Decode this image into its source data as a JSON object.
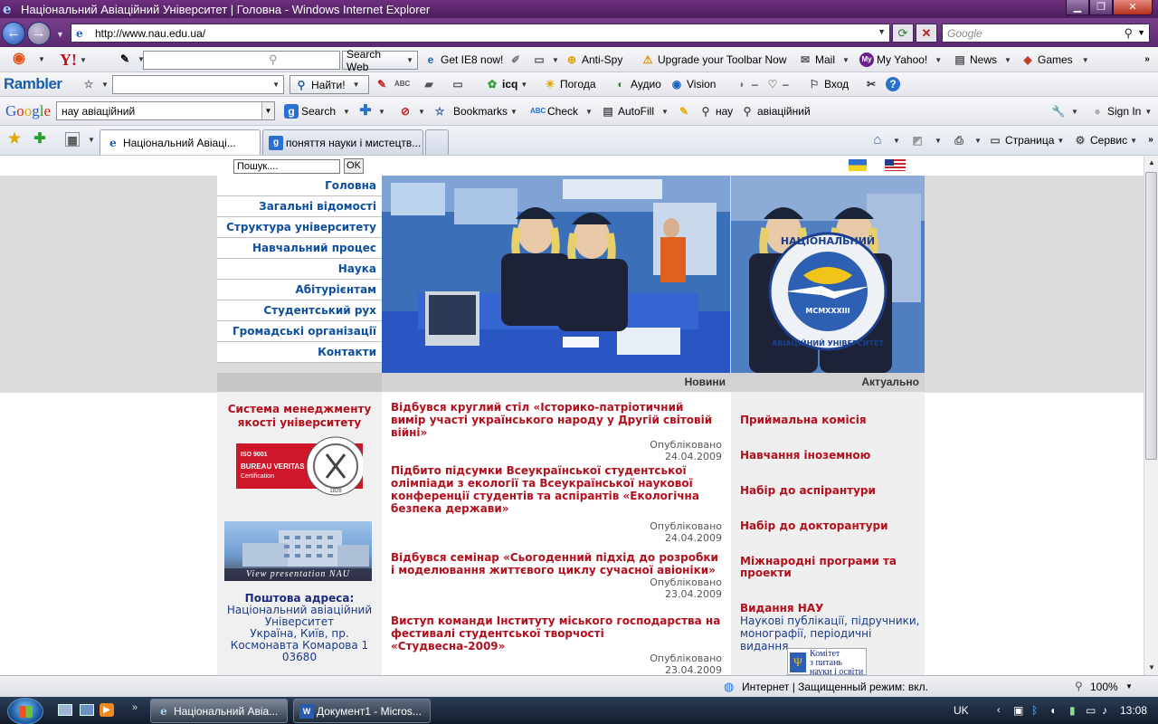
{
  "window": {
    "title": "Національний Авіаційний Університет | Головна - Windows Internet Explorer",
    "ie_glyph": "e"
  },
  "address": {
    "url": "http://www.nau.edu.ua/",
    "search_placeholder": "Google"
  },
  "toolbar1": {
    "search_web": "Search Web",
    "get_ie8": "Get IE8 now!",
    "anti_spy": "Anti-Spy",
    "upgrade": "Upgrade your Toolbar Now",
    "mail": "Mail",
    "my_yahoo": "My Yahoo!",
    "news": "News",
    "games": "Games"
  },
  "toolbar2": {
    "logo": "Rambler",
    "find": "Найти!",
    "icq": "icq",
    "weather": "Погода",
    "audio": "Аудио",
    "vision": "Vision",
    "dash1": "–",
    "dash2": "–",
    "login": "Вход"
  },
  "toolbar3": {
    "logo_letters": [
      "G",
      "o",
      "o",
      "g",
      "l",
      "e"
    ],
    "query": "нау авіаційний",
    "search": "Search",
    "bookmarks": "Bookmarks",
    "check": "Check",
    "autofill": "AutoFill",
    "word1": "нау",
    "word2": "авіаційний",
    "sign_in": "Sign In"
  },
  "tabs": [
    {
      "label": "Національний Авіаці...",
      "active": true
    },
    {
      "label": "поняття науки і мистецтв...",
      "active": false
    }
  ],
  "commandbar": {
    "page": "Страница",
    "tools": "Сервис"
  },
  "site": {
    "search_placeholder": "Пошук....",
    "ok": "OK",
    "nav": [
      "Головна",
      "Загальні відомості",
      "Структура університету",
      "Навчальний процес",
      "Наука",
      "Абітурієнтам",
      "Студентський рух",
      "Громадські організації",
      "Контакти"
    ],
    "news_header": "Новини",
    "actual_header": "Актуально",
    "logo_ring_top": "НАЦІОНАЛЬНИЙ",
    "logo_ring_bottom": "АВІАЦІЙНИЙ УНІВЕРСИТЕТ",
    "logo_year": "MCMXXXIII",
    "quality_title": "Система менеджменту якості університету",
    "bv_lines": [
      "ISO 9001",
      "BUREAU VERITAS",
      "Certification"
    ],
    "bv_seal": "1828",
    "presentation_label": "View presentation NAU",
    "postal_title": "Поштова адреса:",
    "postal_lines": [
      "Національний авіаційний",
      "Університет",
      "Україна, Київ, пр.",
      "Космонавта Комарова 1",
      "03680"
    ],
    "news": [
      {
        "title": "Відбувся круглий стіл «Історико-патріотичний вимір участі українського народу у Другій світовій війні»",
        "published": "Опубліковано",
        "date": "24.04.2009"
      },
      {
        "title": "Підбито підсумки Всеукраїнської студентської олімпіади з екології та Всеукраїнської наукової конференції студентів та аспірантів «Екологічна безпека держави»",
        "published": "Опубліковано",
        "date": "24.04.2009"
      },
      {
        "title": "Відбувся семінар «Сьогоденний підхід до розробки і моделювання життєвого циклу сучасної авіоніки»",
        "published": "Опубліковано",
        "date": "23.04.2009"
      },
      {
        "title": "Виступ команди Інституту міського господарства на фестивалі студентської творчості «Студвесна-2009»",
        "published": "Опубліковано",
        "date": "23.04.2009"
      }
    ],
    "actual": [
      "Приймальна комісія",
      "Навчання іноземною",
      "Набір до аспірантури",
      "Набір до докторантури",
      "Міжнародні програми та проекти",
      "Видання НАУ"
    ],
    "actual_sub": "Наукові публікації, підручники, монографії, періодичні видання",
    "komitet_lines": [
      "Комітет",
      "з питань",
      "науки і освіти"
    ]
  },
  "status": {
    "zone": "Интернет | Защищенный режим: вкл.",
    "zoom": "100%"
  },
  "taskbar": {
    "task1": "Національний Авіа...",
    "task2": "Документ1 - Micros...",
    "lang": "UK",
    "time": "13:08"
  },
  "colors": {
    "title_bar": "#5a2870",
    "link_red": "#b3101d",
    "nav_blue": "#0d4f9c"
  }
}
